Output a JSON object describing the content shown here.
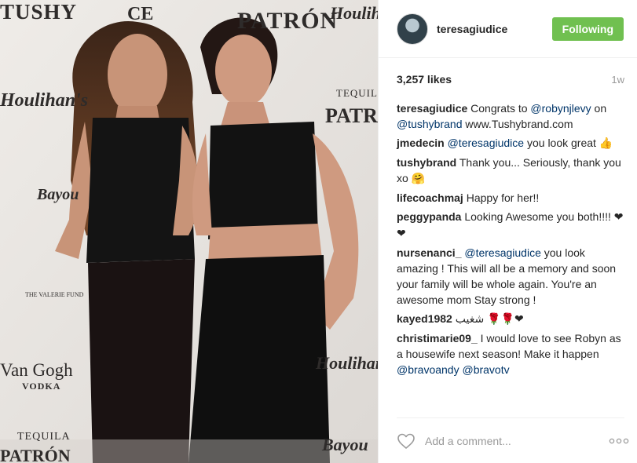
{
  "photo": {
    "logos": {
      "tushy": "TUSHY",
      "ce": "CE",
      "patron_top": "PATRÓN",
      "houlihans_top": "Houlihan's",
      "houlihans_left": "Houlihan's",
      "tequila_right": "TEQUILA",
      "patron_right": "PATRÓ",
      "bayou": "Bayou",
      "valerie": "THE VALERIE FUND",
      "vangogh": "Van Gogh",
      "vodka": "VODKA",
      "tequila_bottom": "TEQUILA",
      "patron_bottom": "PATRÓN",
      "houlihans_right": "Houlihan's",
      "bayou_bottom": "Bayou"
    }
  },
  "header": {
    "username": "teresagiudice",
    "follow_label": "Following",
    "follow_color": "#70c050"
  },
  "stats": {
    "likes": "3,257 likes",
    "time": "1w"
  },
  "comments": [
    {
      "user": "teresagiudice",
      "parts": [
        "Congrats to ",
        "@robynjlevy",
        " on ",
        "@tushybrand",
        " www.Tushybrand.com"
      ]
    },
    {
      "user": "jmedecin",
      "parts": [
        "@teresagiudice",
        " you look great ",
        "👍"
      ]
    },
    {
      "user": "tushybrand",
      "parts": [
        "Thank you... Seriously, thank you xo ",
        "🤗"
      ]
    },
    {
      "user": "lifecoachmaj",
      "parts": [
        "Happy for her!!"
      ]
    },
    {
      "user": "peggypanda",
      "parts": [
        "Looking Awesome you both!!!! ",
        "❤❤"
      ]
    },
    {
      "user": "nursenanci_",
      "parts": [
        "@teresagiudice",
        " you look amazing ! This will all be a memory and soon your family will be whole again. You're an awesome mom Stay strong !"
      ]
    },
    {
      "user": "kayed1982",
      "parts": [
        "شغيب ",
        "🌹🌹❤"
      ]
    },
    {
      "user": "christimarie09_",
      "parts": [
        "I would love to see Robyn as a housewife next season! Make it happen ",
        "@bravoandy",
        " ",
        "@bravotv"
      ]
    }
  ],
  "footer": {
    "comment_placeholder": "Add a comment...",
    "like_icon": "heart-outline-icon",
    "more_icon": "ellipsis-icon"
  },
  "colors": {
    "mention": "#003569",
    "muted": "#999999",
    "text": "#262626"
  }
}
